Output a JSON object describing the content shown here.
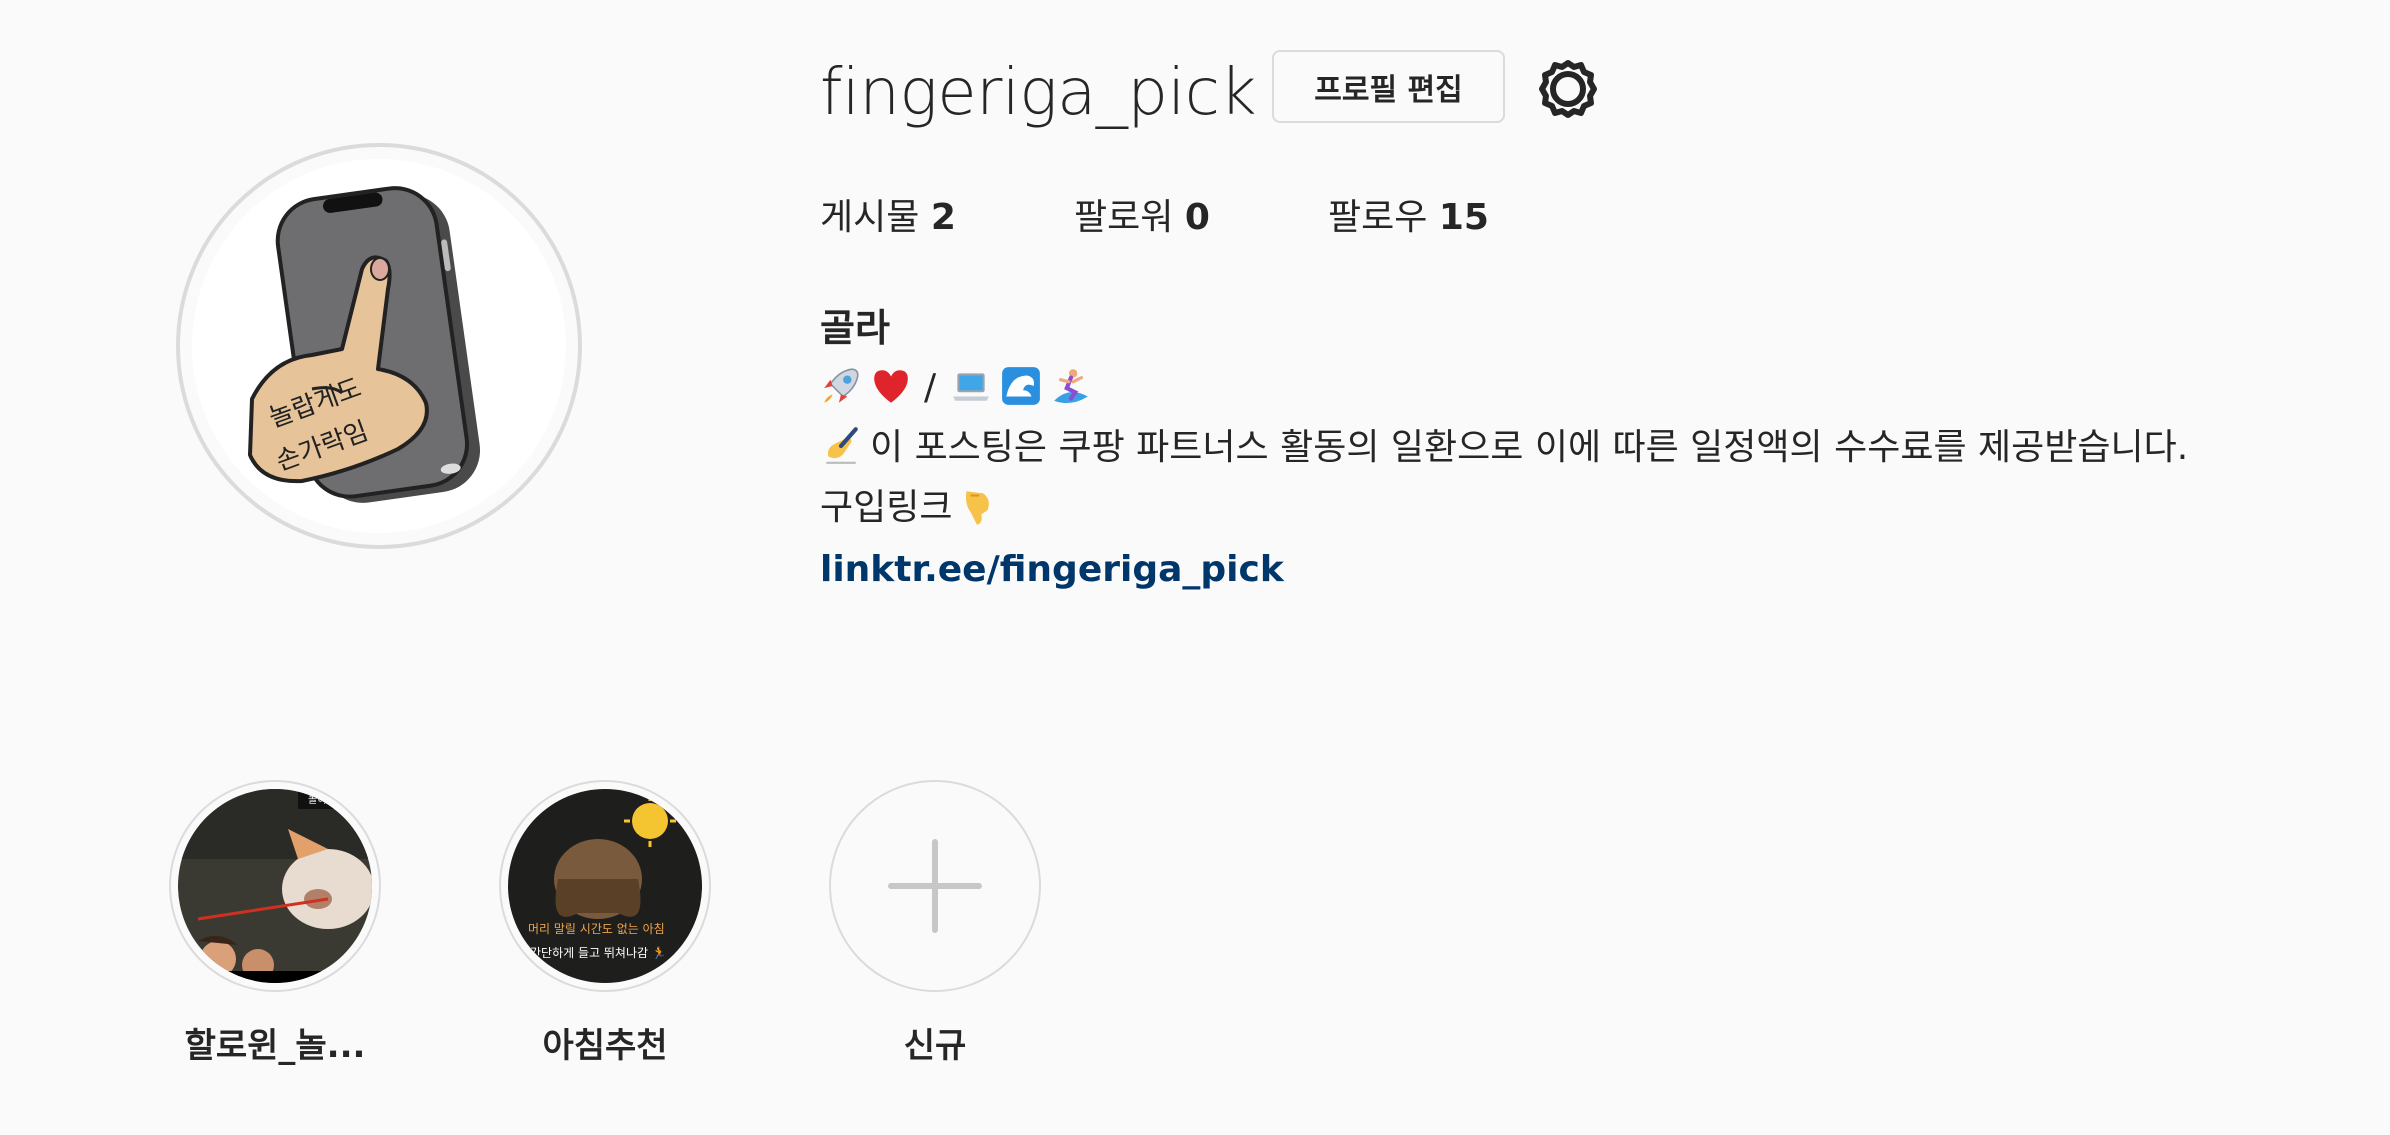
{
  "profile": {
    "username": "fingeriga_pick",
    "edit_button_label": "프로필 편집",
    "settings_icon": "gear-icon",
    "avatar_text_line1": "놀랍게도",
    "avatar_text_line2": "손가락임"
  },
  "stats": {
    "posts_label": "게시물",
    "posts_count": "2",
    "followers_label": "팔로워",
    "followers_count": "0",
    "following_label": "팔로우",
    "following_count": "15"
  },
  "bio": {
    "name": "골라",
    "line1_separator": "/",
    "line1_icons": [
      "rocket-icon",
      "heart-icon",
      "laptop-icon",
      "wave-icon",
      "surfer-icon"
    ],
    "line2_icon": "writing-hand-icon",
    "line2_text": "이 포스팅은 쿠팡 파트너스 활동의 일환으로 이에 따른 일정액의 수수료를 제공받습니다.",
    "line3_text": "구입링크",
    "line3_icon": "pointing-down-icon",
    "link": "linktr.ee/fingeriga_pick"
  },
  "highlights": [
    {
      "label": "할로윈_놀...",
      "thumb_text": "놀이공원"
    },
    {
      "label": "아침추천",
      "thumb_text_line1": "머리 말릴 시간도 없는 아침",
      "thumb_text_line2": "간단하게 들고 뛰쳐나감 🏃"
    },
    {
      "label": "신규",
      "icon": "plus-icon"
    }
  ],
  "colors": {
    "background": "#fafafa",
    "text": "#262626",
    "link": "#00376b",
    "border": "#dbdbdb"
  }
}
